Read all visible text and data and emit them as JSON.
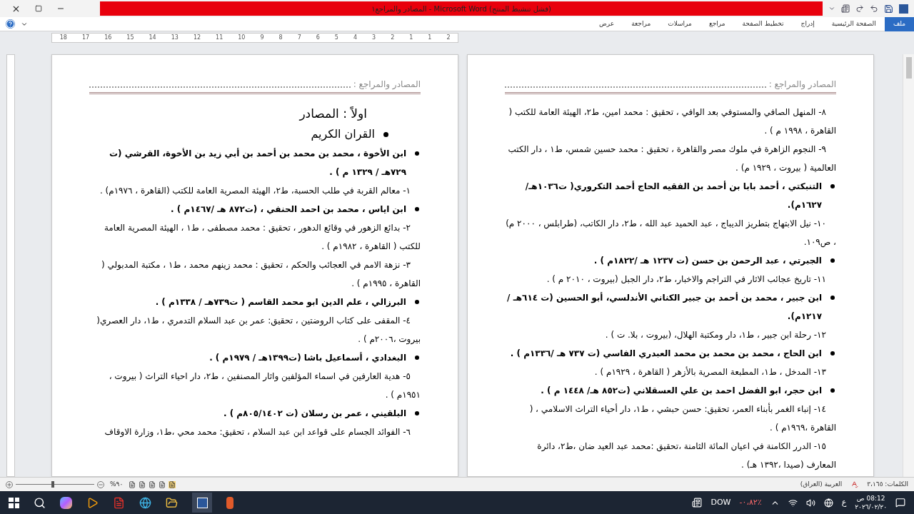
{
  "window": {
    "title": "المصادر والمراجع١ - Microsoft Word (فشل تنشيط المنتج)"
  },
  "tabs": [
    {
      "label": "ملف",
      "selected": true
    },
    {
      "label": "الصفحة الرئيسية",
      "selected": false
    },
    {
      "label": "إدراج",
      "selected": false
    },
    {
      "label": "تخطيط الصفحة",
      "selected": false
    },
    {
      "label": "مراجع",
      "selected": false
    },
    {
      "label": "مراسلات",
      "selected": false
    },
    {
      "label": "مراجعة",
      "selected": false
    },
    {
      "label": "عرض",
      "selected": false
    }
  ],
  "ruler": [
    "2",
    "1",
    "1",
    "2",
    "3",
    "4",
    "5",
    "6",
    "7",
    "8",
    "9",
    "10",
    "11",
    "12",
    "13",
    "14",
    "15",
    "16",
    "17",
    "18"
  ],
  "pages": [
    {
      "header": "المصادر والمراجع :",
      "paragraphs": [
        {
          "kind": "entry",
          "text": "٨- المنهل الصافي والمستوفي بعد الوافي ، تحقيق  : محمد امين، ط٢، الهيئة العامة للكتب ( القاهرة ، ١٩٩٨ م ) ."
        },
        {
          "kind": "entry",
          "text": "٩- النجوم الزاهرة  في ملوك مصر والقاهرة ، تحقيق : محمد حسين شمس، ط١ ، دار الكتب العالمية ( بيروت ، ١٩٢٩ م)  ."
        },
        {
          "kind": "bullet",
          "text": "التنبكتي ، أحمد بابا بن أحمد بن الفقيه الحاج أحمد التكروري( ت١٠٣٦هـ/١٦٢٧م)."
        },
        {
          "kind": "entry",
          "text": "١٠-  نيل الابتهاج بتطريز الديباج ، عبد الحميد عبد الله ، ط٢، دار الكاتب، (طرابلس ، ٢٠٠٠ م) ، ص١٠٩."
        },
        {
          "kind": "bullet",
          "text": "الجبرتي ، عبد الرحمن بن حسن  (ت ١٢٣٧ هـ /١٨٢٢م ) ."
        },
        {
          "kind": "entry",
          "text": "١١- تاريخ عجائب الاثار في التراجم والاخبار، ط٢، دار الجبل (بيروت ، ٢٠١٠ م ) ."
        },
        {
          "kind": "bullet",
          "text": "ابن جبير ، محمد بن أحمد بن جبير الكناني الأندلسي، أبو الحسين (ت ٦١٤هـ / ١٢١٧م)."
        },
        {
          "kind": "entry",
          "text": "١٢-  رحلة ابن جبير ، ط١، دار ومكتبة الهلال، (بيروت ، بلا. ت ) ."
        },
        {
          "kind": "bullet",
          "text": "ابن الحاج ،  محمد بن محمد بن محمد العبدري الفاسي  (ت ٧٣٧ هـ /١٣٣٦م ) ."
        },
        {
          "kind": "entry",
          "text": "١٣- المدخل ، ط١،  المطبعة المصرية بالأزهر  ( القاهرة ، ١٩٢٩م ) ."
        },
        {
          "kind": "bullet",
          "text": "ابن حجر، ابو الفضل احمد بن علي العسقلاني (ت٨٥٢ هـ/ ١٤٤٨ م ) ."
        },
        {
          "kind": "entry",
          "text": "١٤- إنباء الغمر بأبناء العمر، تحقيق: حسن حبشي ، ط١، دار أحياء التراث الاسلامي ، ( القاهرة ،١٩٦٩م ) ."
        },
        {
          "kind": "entry",
          "text": "١٥- الدرر الكامنة في اعيان المائة الثامنة ،تحقيق :محمد عبد العيد ضان ،ط٢، دائرة المعارف (صيدا ،١٣٩٢ هـ)  ."
        }
      ]
    },
    {
      "header": "المصادر والمراجع :",
      "paragraphs": [
        {
          "kind": "heading",
          "text": "اولاً : المصادر"
        },
        {
          "kind": "bullet_large",
          "text": "القران الكريم"
        },
        {
          "kind": "bullet",
          "text": "ابن الأخوة ، محمد بن محمد بن أحمد بن أبي زيد بن الأخوة، القرشي  (ت ٧٢٩هـ / ١٣٢٩ م ) ."
        },
        {
          "kind": "entry",
          "text": "١- معالم القربة في طلب الحسبة، ط٢، الهيئة المصرية العامة للكتب (القاهرة ، ١٩٧٦م)  ."
        },
        {
          "kind": "bullet",
          "text": "ابن اياس ، محمد بن احمد الحنفي ، (ت٨٧٢ هـ /١٤٦٧م ) ."
        },
        {
          "kind": "entry",
          "text": "٢- بدائع الزهور في وقائع الدهور ، تحقيق : محمد مصطفى ، ط١ ، الهيئة المصرية العامة للكتب  ( القاهرة ، ١٩٨٢م ) ."
        },
        {
          "kind": "entry",
          "text": "٣-  نزهة الامم في العجائب والحكم ، تحقيق : محمد زينهم محمد ، ط١ ، مكتبة المدبولي ( القاهرة ، ١٩٩٥م ) ."
        },
        {
          "kind": "bullet",
          "text": "البرزالي ، علم الدين ابو محمد القاسم ( ت٧٣٩هـ / ١٣٣٨م ) ."
        },
        {
          "kind": "entry",
          "text": "٤- المقفى على كتاب الروضتين ، تحقيق: عمر بن عبد السلام التدمري ، ط١، دار العصري( بيروت  ،٢٠٠٦م ) ."
        },
        {
          "kind": "bullet",
          "text": "البغدادي ، أسماعيل باشا  (ت١٣٩٩هـ / ١٩٧٩م ) ."
        },
        {
          "kind": "entry",
          "text": "٥- هدية العارفين في اسماء المؤلفين واثار المصنفين ، ط٢، دار احياء التراث ( بيروت ، ١٩٥١م ) ."
        },
        {
          "kind": "bullet",
          "text": "البلقيني ، عمر بن رسلان  (ت ٨٠٥/١٤٠٢م ) ."
        },
        {
          "kind": "entry",
          "text": "٦- الفوائد الجسام على قواعد ابن عبد السلام ، تحقيق: محمد محي ،ط١، وزارة الاوقاف"
        }
      ]
    }
  ],
  "status_bar": {
    "words": "الكلمات: ٣،١٦٥",
    "language": "العربية (العراق)",
    "zoom": "%٩٠",
    "zoom_slider": {
      "level": 0.45
    }
  },
  "taskbar": {
    "ticker": "DOW",
    "ticker_change": "٪٠،٨٢-",
    "input_language": "ع",
    "time": "08:12 ص",
    "date": "٢٠٢٦/٠٢/٢٠"
  }
}
